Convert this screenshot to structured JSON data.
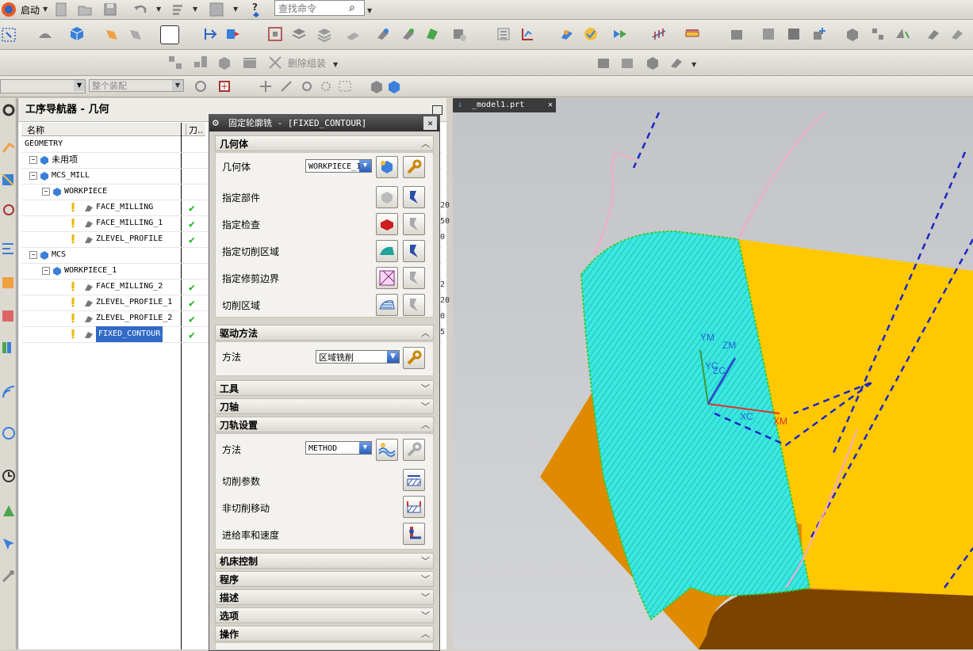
{
  "toolbar": {
    "start_label": "启动",
    "search_placeholder": "查找命令",
    "delete_group_label": "删除组装",
    "assembly_select": "整个装配"
  },
  "navigator": {
    "title": "工序导航器 - 几何",
    "col_name": "名称",
    "col_tool": "刀..",
    "rows": [
      {
        "label": "GEOMETRY",
        "indent": 0,
        "check": false
      },
      {
        "label": "未用项",
        "indent": 1,
        "check": false
      },
      {
        "label": "MCS_MILL",
        "indent": 1,
        "check": false
      },
      {
        "label": "WORKPIECE",
        "indent": 2,
        "check": false
      },
      {
        "label": "FACE_MILLING",
        "indent": 3,
        "check": true
      },
      {
        "label": "FACE_MILLING_1",
        "indent": 3,
        "check": true
      },
      {
        "label": "ZLEVEL_PROFILE",
        "indent": 3,
        "check": true
      },
      {
        "label": "MCS",
        "indent": 1,
        "check": false
      },
      {
        "label": "WORKPIECE_1",
        "indent": 2,
        "check": false
      },
      {
        "label": "FACE_MILLING_2",
        "indent": 3,
        "check": true
      },
      {
        "label": "ZLEVEL_PROFILE_1",
        "indent": 3,
        "check": true
      },
      {
        "label": "ZLEVEL_PROFILE_2",
        "indent": 3,
        "check": true
      },
      {
        "label": "FIXED_CONTOUR",
        "indent": 3,
        "check": true,
        "selected": true
      }
    ],
    "side_values": [
      "20",
      "50",
      "0",
      "2",
      "20",
      "0",
      "5"
    ],
    "check_mark": "✔"
  },
  "dialog": {
    "title": "固定轮廓铣 - [FIXED_CONTOUR]",
    "close": "✕",
    "sections": {
      "geometry": "几何体",
      "drive": "驱动方法",
      "tool": "工具",
      "axis": "刀轴",
      "path": "刀轨设置",
      "machine": "机床控制",
      "program": "程序",
      "description": "描述",
      "options": "选项",
      "actions": "操作"
    },
    "geometry": {
      "geometry_label": "几何体",
      "geometry_value": "WORKPIECE_1",
      "part_label": "指定部件",
      "check_label": "指定检查",
      "cut_area_label": "指定切削区域",
      "trim_label": "指定修剪边界",
      "cut_region_label": "切削区域"
    },
    "drive": {
      "method_label": "方法",
      "method_value": "区域铣削"
    },
    "path": {
      "method_label": "方法",
      "method_value": "METHOD",
      "cut_params_label": "切削参数",
      "non_cut_label": "非切削移动",
      "feeds_label": "进给率和速度"
    }
  },
  "viewport": {
    "tab_label": "_model1.prt",
    "axis_labels": {
      "ym": "YM",
      "zm": "ZM",
      "yc": "YC",
      "zc": "ZC",
      "xc": "XC",
      "xm": "XM"
    }
  },
  "colors": {
    "accent_blue": "#3169c6",
    "check_green": "#17b31c",
    "part_yellow": "#ffc800",
    "part_orange": "#e08a00",
    "toolpath_cyan": "#2fe8e0"
  }
}
